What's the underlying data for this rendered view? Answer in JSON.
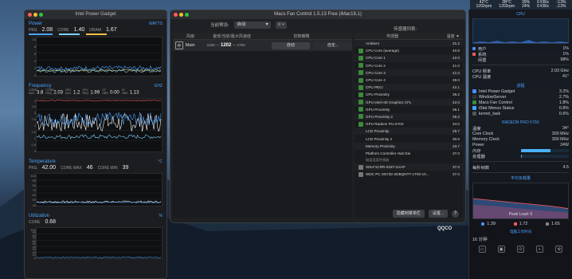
{
  "menubar": {
    "items": [
      {
        "top": "42°C",
        "bottom": "1202rpm"
      },
      {
        "top": "3B°C",
        "bottom": "1202rpm"
      },
      {
        "top": "39%",
        "bottom": "24%"
      },
      {
        "top": "0 KB/s",
        "bottom": "0 KB/s"
      },
      {
        "top": "↑13%",
        "bottom": "↓13%"
      }
    ]
  },
  "ipg": {
    "title": "Intel Power Gadget",
    "power": {
      "label": "Power",
      "unit": "WATTS",
      "pkg_label": "PKG",
      "pkg": "2.08",
      "core_label": "CORE",
      "core": "1.40",
      "dram_label": "DRAM",
      "dram": "1.67",
      "colors": {
        "pkg": "#4aa3ff",
        "core": "#7ed2ff",
        "dram": "#f0c040"
      },
      "yticks": [
        "10",
        "8",
        "6",
        "4",
        "2",
        "0"
      ]
    },
    "frequency": {
      "label": "Frequency",
      "unit": "GHZ",
      "items": [
        {
          "l": "CORE AVG",
          "v": "3.8"
        },
        {
          "l": "CORE REQ",
          "v": "2.03"
        },
        {
          "l": "GFX AVG",
          "v": "1.2"
        },
        {
          "l": "GFX REQ",
          "v": "1.99"
        },
        {
          "l": "GT OBS",
          "v": "0.00"
        },
        {
          "l": "IO OBS",
          "v": "1.13"
        }
      ],
      "yticks": [
        "4",
        "3.5",
        "3",
        "2.5",
        "2",
        "1.5",
        "1",
        "0.5",
        "0"
      ]
    },
    "temperature": {
      "label": "Temperature",
      "unit": "°C",
      "pkg_label": "PKG",
      "pkg": "42.00",
      "core_max_label": "CORE MAX",
      "core_max": "46",
      "core_min_label": "CORE MIN",
      "core_min": "39",
      "yticks": [
        "100",
        "90",
        "80",
        "70",
        "60",
        "50",
        "40"
      ]
    },
    "utilization": {
      "label": "Utilization",
      "unit": "%",
      "core_label": "CORE",
      "core": "0.68",
      "yticks": [
        "100",
        "90",
        "80",
        "70",
        "60",
        "50",
        "40",
        "30",
        "20",
        "10",
        "0"
      ]
    }
  },
  "mfc": {
    "title": "Macs Fan Control 1.5.13 Free (iMac19,1)",
    "preset_label": "当前预设:",
    "preset_value": "自动",
    "gear": "⚙ ▾",
    "sensors_title": "传感器列表:",
    "fan_headers": [
      "风扇",
      "最低/当前/最大风速值",
      "控制策略"
    ],
    "fans": [
      {
        "name": "Main",
        "min": "1200",
        "cur": "1202",
        "max": "2700",
        "auto": "自动",
        "custom": "自定..."
      }
    ],
    "sensor_headers": [
      "传感器",
      "温度 ▼"
    ],
    "sensors": [
      {
        "n": "Ambient",
        "v": "31.2",
        "ic": "none"
      },
      {
        "n": "CPU Core (average)",
        "v": "40.8",
        "ic": "green"
      },
      {
        "n": "CPU Core 1",
        "v": "42.0",
        "ic": "green"
      },
      {
        "n": "CPU Core 2",
        "v": "41.0",
        "ic": "green"
      },
      {
        "n": "CPU Core 3",
        "v": "41.0",
        "ic": "green"
      },
      {
        "n": "CPU Core 4",
        "v": "39.0",
        "ic": "green"
      },
      {
        "n": "CPU PECI",
        "v": "42.1",
        "ic": "green"
      },
      {
        "n": "CPU Proximity",
        "v": "39.2",
        "ic": "green"
      },
      {
        "n": "GPU Intel HD Graphics CFL",
        "v": "42.0",
        "ic": "green"
      },
      {
        "n": "GPU Proximity",
        "v": "38.1",
        "ic": "green"
      },
      {
        "n": "GPU Proximity 2",
        "v": "36.3",
        "ic": "green"
      },
      {
        "n": "GPU Radeon Pro 570X",
        "v": "34.0",
        "ic": "green"
      },
      {
        "n": "LCD Proximity",
        "v": "29.7",
        "ic": "none"
      },
      {
        "n": "LCD Proximity 2",
        "v": "30.6",
        "ic": "none"
      },
      {
        "n": "Memory Proximity",
        "v": "33.7",
        "ic": "none"
      },
      {
        "n": "Platform Controller Hub Die",
        "v": "37.0",
        "ic": "none"
      }
    ],
    "disk_group": "磁盘温度传感器",
    "disks": [
      {
        "n": "SDLF1CRR-019T-1HAP",
        "v": "37.0"
      },
      {
        "n": "WDC PC SN730 SDBQNTY-1T00-10...",
        "v": "37.0"
      }
    ],
    "hide_button": "隐藏到菜单栏",
    "settings_button": "设置...",
    "help": "?"
  },
  "qqco": "QQCO",
  "istat": {
    "cpu_title": "CPU",
    "cpu_rows": [
      {
        "l": "用户",
        "v": "1%",
        "c": "#4a8cff"
      },
      {
        "l": "系统",
        "v": "1%",
        "c": "#ff5a5a"
      },
      {
        "l": "闲置",
        "v": "98%",
        "c": ""
      }
    ],
    "cpu_freq_label": "CPU 频率",
    "cpu_freq": "2.93 GHz",
    "cpu_temp_label": "CPU 温度",
    "cpu_temp": "41°",
    "proc_title": "进程",
    "procs": [
      {
        "n": "Intel Power Gadget",
        "v": "3.2%",
        "c": "#4a8cff"
      },
      {
        "n": "WindowServer",
        "v": "2.7%",
        "c": "#333"
      },
      {
        "n": "Macs Fan Control",
        "v": "1.8%",
        "c": "#3b8b3b"
      },
      {
        "n": "iStat Menus Status",
        "v": "0.8%",
        "c": "#4aa3ff"
      },
      {
        "n": "kernel_task",
        "v": "0.6%",
        "c": "#555"
      }
    ],
    "gpu_title": "RADEON PRO 570X",
    "gpu_rows": [
      {
        "l": "温度",
        "v": "34°"
      },
      {
        "l": "Core Clock",
        "v": "300 MHz"
      },
      {
        "l": "Memory Clock",
        "v": "300 MHz"
      },
      {
        "l": "Power",
        "v": "24W"
      }
    ],
    "gpu_mem_label": "内存",
    "gpu_mem": 0.62,
    "gpu_proc_label": "处理器",
    "gpu_proc": 0.02,
    "fps_label": "每秒帧数",
    "fps": "4.5",
    "avg_load_title": "平均负载量",
    "peak_label": "Peak Load: 5",
    "loads": [
      {
        "v": "1.39",
        "c": "#4a8cff"
      },
      {
        "v": "1.72",
        "c": "#ff5a5a"
      },
      {
        "v": "1.65",
        "c": "#888"
      }
    ],
    "uptime_title": "电脑工作时间",
    "uptime": "16 分钟"
  }
}
